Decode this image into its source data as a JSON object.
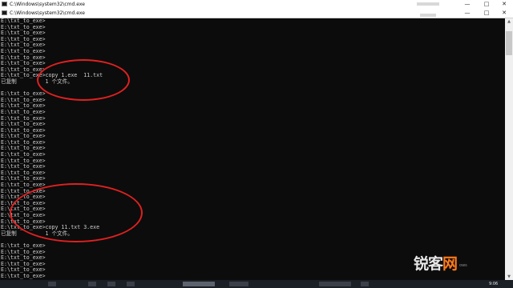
{
  "windows": {
    "back_title": "C:\\Windows\\system32\\cmd.exe",
    "front_title": "C:\\Windows\\system32\\cmd.exe",
    "controls": {
      "minimize": "—",
      "maximize": "□",
      "close": "✕"
    }
  },
  "console": {
    "lines": [
      "E:\\txt_to_exe>",
      "E:\\txt_to_exe>",
      "E:\\txt_to_exe>",
      "E:\\txt_to_exe>",
      "E:\\txt_to_exe>",
      "E:\\txt_to_exe>",
      "E:\\txt_to_exe>",
      "E:\\txt_to_exe>",
      "E:\\txt_to_exe>",
      "E:\\txt_to_exe>copy 1.exe  11.txt",
      "已复制         1 个文件。",
      "",
      "E:\\txt_to_exe>",
      "E:\\txt_to_exe>",
      "E:\\txt_to_exe>",
      "E:\\txt_to_exe>",
      "E:\\txt_to_exe>",
      "E:\\txt_to_exe>",
      "E:\\txt_to_exe>",
      "E:\\txt_to_exe>",
      "E:\\txt_to_exe>",
      "E:\\txt_to_exe>",
      "E:\\txt_to_exe>",
      "E:\\txt_to_exe>",
      "E:\\txt_to_exe>",
      "E:\\txt_to_exe>",
      "E:\\txt_to_exe>",
      "E:\\txt_to_exe>",
      "E:\\txt_to_exe>",
      "E:\\txt_to_exe>",
      "E:\\txt_to_exe>",
      "E:\\txt_to_exe>",
      "E:\\txt_to_exe>",
      "E:\\txt_to_exe>",
      "E:\\txt_to_exe>copy 11.txt 3.exe",
      "已复制         1 个文件。",
      "",
      "E:\\txt_to_exe>",
      "E:\\txt_to_exe>",
      "E:\\txt_to_exe>",
      "E:\\txt_to_exe>",
      "E:\\txt_to_exe>",
      "E:\\txt_to_exe>",
      "E:\\txt_to_exe>",
      "E:\\txt_to_exe>",
      "E:\\txt_to_exe>"
    ]
  },
  "taskbar": {
    "clock": "9:06"
  },
  "watermark": {
    "brand_main": "锐客",
    "brand_accent": "网",
    "subtext": "ows"
  },
  "colors": {
    "console_bg": "#0c0c0c",
    "console_text": "#cfcfcf",
    "annotation": "#e02020",
    "accent": "#ff7a1a"
  },
  "icons": [
    "cmd-app-icon",
    "minimize-icon",
    "maximize-icon",
    "close-icon",
    "scroll-up-icon",
    "scroll-down-icon"
  ]
}
